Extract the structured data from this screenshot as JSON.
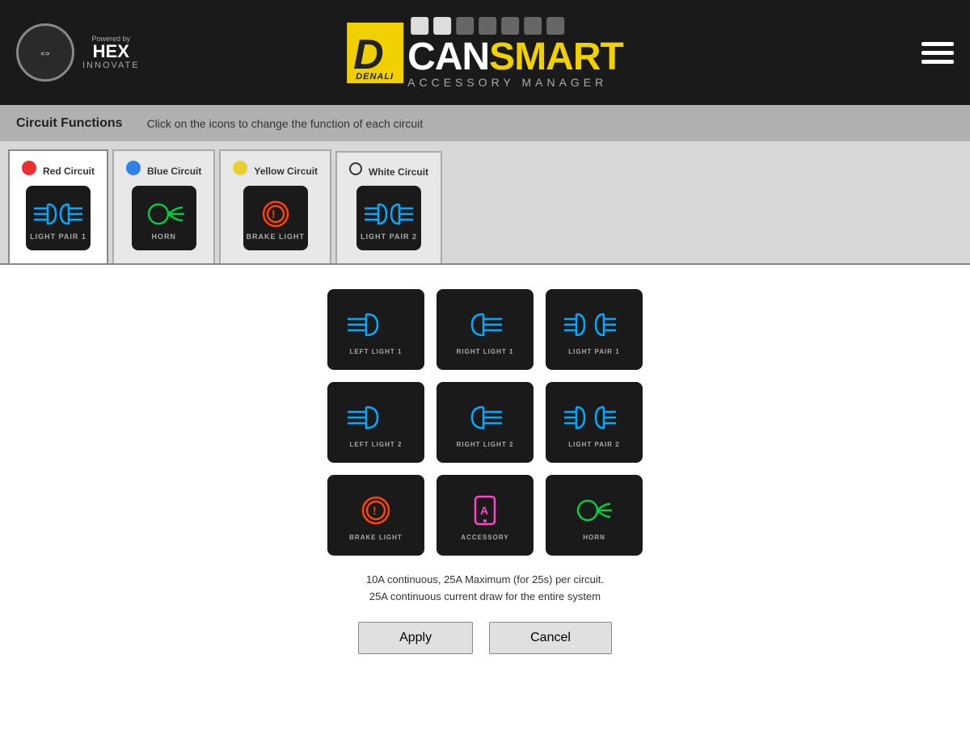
{
  "header": {
    "powered_by": "Powered by",
    "brand_name": "HEX",
    "brand_sub": "INNOVATE",
    "product_name_can": "CAN",
    "product_name_smart": "SMART",
    "product_sub": "ACCESSORY MANAGER",
    "menu_icon": "hamburger-icon"
  },
  "circuit_bar": {
    "title": "Circuit Functions",
    "hint": "Click on the icons to change the function of each circuit"
  },
  "circuits": [
    {
      "id": "red",
      "name": "Red Circuit",
      "dot": "red",
      "function": "LIGHT PAIR 1",
      "active": true
    },
    {
      "id": "blue",
      "name": "Blue Circuit",
      "dot": "blue",
      "function": "HORN",
      "active": false
    },
    {
      "id": "yellow",
      "name": "Yellow Circuit",
      "dot": "yellow",
      "function": "BRAKE LIGHT",
      "active": false
    },
    {
      "id": "white",
      "name": "White Circuit",
      "dot": "white",
      "function": "LIGHT PAIR 2",
      "active": false
    }
  ],
  "icon_grid": {
    "row1": [
      {
        "id": "left-light-1",
        "label": "LEFT LIGHT 1",
        "type": "left-light"
      },
      {
        "id": "right-light-1",
        "label": "RIGHT LIGHT 1",
        "type": "right-light"
      },
      {
        "id": "light-pair-1",
        "label": "LIGHT PAIR 1",
        "type": "light-pair"
      }
    ],
    "row2": [
      {
        "id": "left-light-2",
        "label": "LEFT LIGHT 2",
        "type": "left-light"
      },
      {
        "id": "right-light-2",
        "label": "RIGHT LIGHT 2",
        "type": "right-light"
      },
      {
        "id": "light-pair-2",
        "label": "LIGHT PAIR 2",
        "type": "light-pair"
      }
    ],
    "row3": [
      {
        "id": "brake-light",
        "label": "BRAKE LIGHT",
        "type": "brake"
      },
      {
        "id": "accessory",
        "label": "ACCESSORY",
        "type": "accessory"
      },
      {
        "id": "horn",
        "label": "HORN",
        "type": "horn"
      }
    ]
  },
  "info": {
    "line1": "10A continuous, 25A Maximum (for 25s) per circuit.",
    "line2": "25A continuous current  draw for the entire system"
  },
  "buttons": {
    "apply": "Apply",
    "cancel": "Cancel"
  }
}
